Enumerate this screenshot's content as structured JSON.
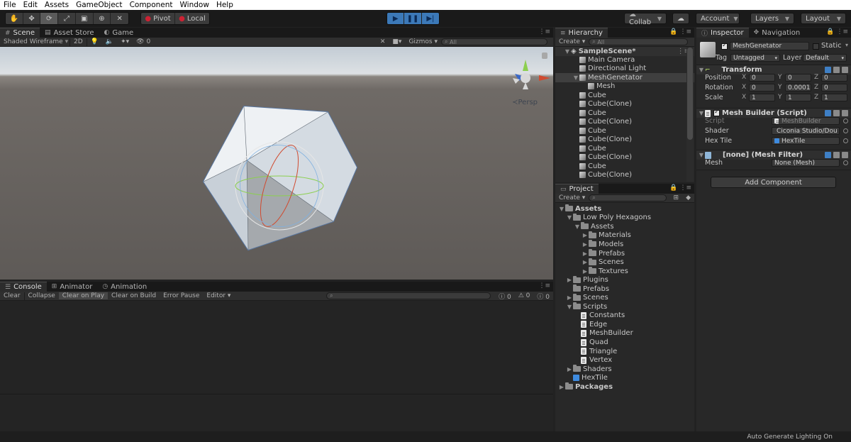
{
  "menubar": {
    "items": [
      "File",
      "Edit",
      "Assets",
      "GameObject",
      "Component",
      "Window",
      "Help"
    ]
  },
  "toolbar": {
    "pivot": "Pivot",
    "local": "Local",
    "collab": "Collab",
    "account": "Account",
    "layers": "Layers",
    "layout": "Layout"
  },
  "scene": {
    "tabs": [
      "Scene",
      "Asset Store",
      "Game"
    ],
    "draw_mode": "Shaded Wireframe",
    "mode_2d": "2D",
    "gizmos": "Gizmos",
    "search_placeholder": "All",
    "hidden_count": "0",
    "persp_label": "Persp"
  },
  "console": {
    "tabs": [
      "Console",
      "Animator",
      "Animation"
    ],
    "buttons": [
      "Clear",
      "Collapse",
      "Clear on Play",
      "Clear on Build",
      "Error Pause",
      "Editor"
    ],
    "counts": [
      "0",
      "0",
      "0"
    ]
  },
  "hierarchy": {
    "title": "Hierarchy",
    "create": "Create",
    "search_placeholder": "All",
    "scene_name": "SampleScene*",
    "items": [
      {
        "label": "Main Camera",
        "depth": 1,
        "expander": false,
        "selected": false
      },
      {
        "label": "Directional Light",
        "depth": 1,
        "expander": false,
        "selected": false
      },
      {
        "label": "MeshGenetator",
        "depth": 1,
        "expander": true,
        "selected": true
      },
      {
        "label": "Mesh",
        "depth": 2,
        "expander": false,
        "selected": false
      },
      {
        "label": "Cube",
        "depth": 1,
        "expander": false,
        "selected": false
      },
      {
        "label": "Cube(Clone)",
        "depth": 1,
        "expander": false,
        "selected": false
      },
      {
        "label": "Cube",
        "depth": 1,
        "expander": false,
        "selected": false
      },
      {
        "label": "Cube(Clone)",
        "depth": 1,
        "expander": false,
        "selected": false
      },
      {
        "label": "Cube",
        "depth": 1,
        "expander": false,
        "selected": false
      },
      {
        "label": "Cube(Clone)",
        "depth": 1,
        "expander": false,
        "selected": false
      },
      {
        "label": "Cube",
        "depth": 1,
        "expander": false,
        "selected": false
      },
      {
        "label": "Cube(Clone)",
        "depth": 1,
        "expander": false,
        "selected": false
      },
      {
        "label": "Cube",
        "depth": 1,
        "expander": false,
        "selected": false
      },
      {
        "label": "Cube(Clone)",
        "depth": 1,
        "expander": false,
        "selected": false
      }
    ]
  },
  "project": {
    "title": "Project",
    "create": "Create",
    "items": [
      {
        "label": "Assets",
        "depth": 0,
        "icon": "folder",
        "arrow": "down",
        "bold": true
      },
      {
        "label": "Low Poly Hexagons",
        "depth": 1,
        "icon": "folder",
        "arrow": "down",
        "bold": false
      },
      {
        "label": "Assets",
        "depth": 2,
        "icon": "folder",
        "arrow": "down",
        "bold": false
      },
      {
        "label": "Materials",
        "depth": 3,
        "icon": "folder",
        "arrow": "right",
        "bold": false
      },
      {
        "label": "Models",
        "depth": 3,
        "icon": "folder",
        "arrow": "right",
        "bold": false
      },
      {
        "label": "Prefabs",
        "depth": 3,
        "icon": "folder",
        "arrow": "right",
        "bold": false
      },
      {
        "label": "Scenes",
        "depth": 3,
        "icon": "folder",
        "arrow": "right",
        "bold": false
      },
      {
        "label": "Textures",
        "depth": 3,
        "icon": "folder",
        "arrow": "right",
        "bold": false
      },
      {
        "label": "Plugins",
        "depth": 1,
        "icon": "folder",
        "arrow": "right",
        "bold": false
      },
      {
        "label": "Prefabs",
        "depth": 1,
        "icon": "folder",
        "arrow": "none",
        "bold": false
      },
      {
        "label": "Scenes",
        "depth": 1,
        "icon": "folder",
        "arrow": "right",
        "bold": false
      },
      {
        "label": "Scripts",
        "depth": 1,
        "icon": "folder",
        "arrow": "down",
        "bold": false
      },
      {
        "label": "Constants",
        "depth": 2,
        "icon": "script",
        "arrow": "none",
        "bold": false
      },
      {
        "label": "Edge",
        "depth": 2,
        "icon": "script",
        "arrow": "none",
        "bold": false
      },
      {
        "label": "MeshBuilder",
        "depth": 2,
        "icon": "script",
        "arrow": "none",
        "bold": false
      },
      {
        "label": "Quad",
        "depth": 2,
        "icon": "script",
        "arrow": "none",
        "bold": false
      },
      {
        "label": "Triangle",
        "depth": 2,
        "icon": "script",
        "arrow": "none",
        "bold": false
      },
      {
        "label": "Vertex",
        "depth": 2,
        "icon": "script",
        "arrow": "none",
        "bold": false
      },
      {
        "label": "Shaders",
        "depth": 1,
        "icon": "folder",
        "arrow": "right",
        "bold": false
      },
      {
        "label": "HexTile",
        "depth": 1,
        "icon": "prefab",
        "arrow": "none",
        "bold": false
      },
      {
        "label": "Packages",
        "depth": 0,
        "icon": "folder",
        "arrow": "right",
        "bold": true
      }
    ]
  },
  "inspector": {
    "tabs": [
      "Inspector",
      "Navigation"
    ],
    "object_name": "MeshGenetator",
    "static_label": "Static",
    "tag_label": "Tag",
    "tag_value": "Untagged",
    "layer_label": "Layer",
    "layer_value": "Default",
    "transform": {
      "title": "Transform",
      "rows": [
        {
          "label": "Position",
          "x": "0",
          "y": "0",
          "z": "0"
        },
        {
          "label": "Rotation",
          "x": "0",
          "y": "0.0001",
          "z": "0"
        },
        {
          "label": "Scale",
          "x": "1",
          "y": "1",
          "z": "1"
        }
      ]
    },
    "mesh_builder": {
      "title": "Mesh Builder (Script)",
      "script_label": "Script",
      "script_value": "MeshBuilder",
      "shader_label": "Shader",
      "shader_value": "Ciconia Studio/Dou",
      "hextile_label": "Hex Tile",
      "hextile_value": "HexTile"
    },
    "mesh_filter": {
      "title": "[none] (Mesh Filter)",
      "mesh_label": "Mesh",
      "mesh_value": "None (Mesh)"
    },
    "add_component": "Add Component"
  },
  "status": {
    "text": "Auto Generate Lighting On"
  }
}
